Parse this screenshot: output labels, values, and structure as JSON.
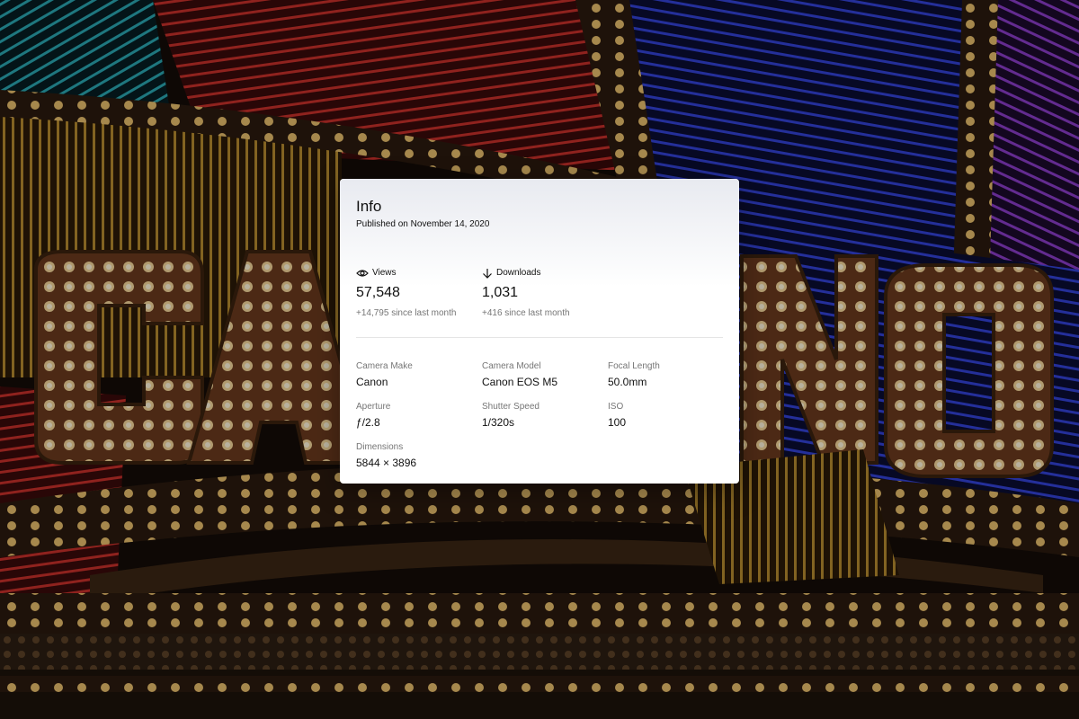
{
  "info": {
    "title": "Info",
    "published": "Published on November 14, 2020"
  },
  "stats": [
    {
      "label": "Views",
      "icon": "eye-icon",
      "value": "57,548",
      "delta": "+14,795 since last month"
    },
    {
      "label": "Downloads",
      "icon": "arrow-down-icon",
      "value": "1,031",
      "delta": "+416 since last month"
    }
  ],
  "exif": [
    {
      "label": "Camera Make",
      "value": "Canon"
    },
    {
      "label": "Camera Model",
      "value": "Canon EOS M5"
    },
    {
      "label": "Focal Length",
      "value": "50.0mm"
    },
    {
      "label": "Aperture",
      "value": "ƒ/2.8"
    },
    {
      "label": "Shutter Speed",
      "value": "1/320s"
    },
    {
      "label": "ISO",
      "value": "100"
    },
    {
      "label": "Dimensions",
      "value": "5844 × 3896"
    }
  ]
}
